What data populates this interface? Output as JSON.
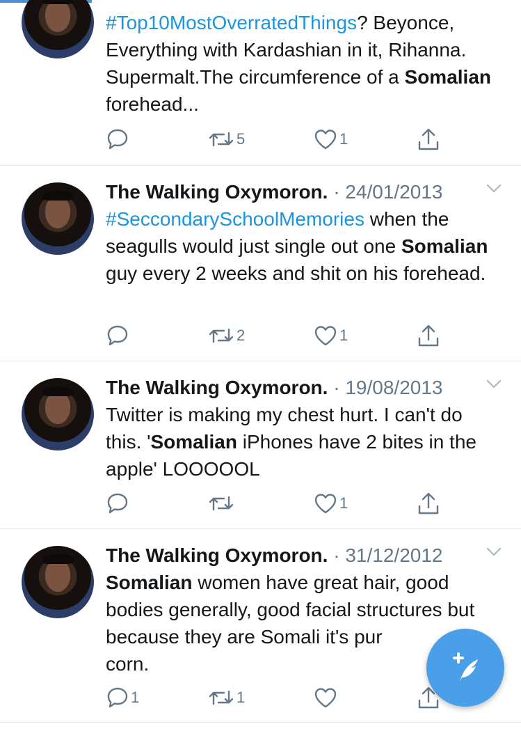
{
  "tweets": [
    {
      "author": "",
      "separator": "",
      "date": "",
      "body": [
        {
          "text": "#Top10MostOverratedThings",
          "style": "hashtag"
        },
        {
          "text": "? Beyonce, Everything with Kardashian in it, Rihanna. Supermalt.The circumference of a ",
          "style": "normal"
        },
        {
          "text": "Somalian",
          "style": "bold"
        },
        {
          "text": " forehead...",
          "style": "normal"
        }
      ],
      "reply_count": "",
      "retweet_count": "5",
      "like_count": "1"
    },
    {
      "author": "The Walking Oxymoron.",
      "separator": "·",
      "date": "24/01/2013",
      "body": [
        {
          "text": "#SeccondarySchoolMemories",
          "style": "hashtag"
        },
        {
          "text": " when the seagulls would just single out one ",
          "style": "normal"
        },
        {
          "text": "Somalian",
          "style": "bold"
        },
        {
          "text": " guy every 2 weeks and shit on his forehead.",
          "style": "normal"
        }
      ],
      "reply_count": "",
      "retweet_count": "2",
      "like_count": "1"
    },
    {
      "author": "The Walking Oxymoron.",
      "separator": "·",
      "date": "19/08/2013",
      "body": [
        {
          "text": "Twitter is making my chest hurt. I can't do this. '",
          "style": "normal"
        },
        {
          "text": "Somalian",
          "style": "bold"
        },
        {
          "text": " iPhones have 2 bites in the apple' LOOOOOL",
          "style": "normal"
        }
      ],
      "reply_count": "",
      "retweet_count": "",
      "like_count": "1"
    },
    {
      "author": "The Walking Oxymoron.",
      "separator": "·",
      "date": "31/12/2012",
      "body": [
        {
          "text": "Somalian",
          "style": "bold"
        },
        {
          "text": " women have great hair, good bodies generally, good facial structures but because they are Somali it's pur",
          "style": "normal"
        },
        {
          "text": "corn.",
          "style": "normal"
        }
      ],
      "reply_count": "1",
      "retweet_count": "1",
      "like_count": ""
    }
  ],
  "icons": {
    "reply": "reply-bubble-icon",
    "retweet": "retweet-arrows-icon",
    "like": "heart-outline-icon",
    "share": "share-upload-icon",
    "compose": "compose-feather-icon",
    "caret": "chevron-down-icon"
  },
  "colors": {
    "text": "#14171a",
    "secondary": "#657786",
    "hashtag": "#1b95e0",
    "divider": "#e1e8ed",
    "fab": "#4a9fe8",
    "accent": "#4a90d9"
  }
}
